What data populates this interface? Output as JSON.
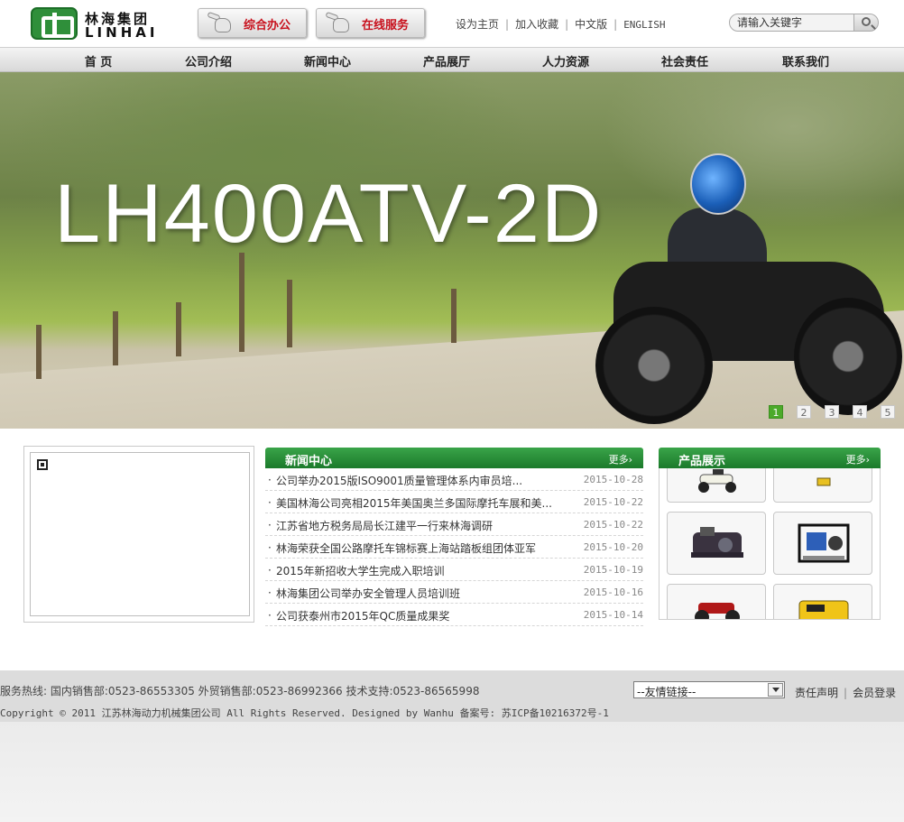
{
  "header": {
    "logo_cn": "林海集团",
    "logo_en": "LINHAI",
    "btn_office": "综合办公",
    "btn_service": "在线服务",
    "links": [
      "设为主页",
      "加入收藏",
      "中文版",
      "ENGLISH"
    ],
    "search_placeholder": "请输入关键字"
  },
  "nav": [
    "首 页",
    "公司介绍",
    "新闻中心",
    "产品展厅",
    "人力资源",
    "社会责任",
    "联系我们"
  ],
  "banner": {
    "text": "LH400ATV-2D",
    "slides": [
      "1",
      "2",
      "3",
      "4",
      "5"
    ],
    "active_slide": 0
  },
  "news": {
    "title": "新闻中心",
    "more": "更多›",
    "items": [
      {
        "title": "公司举办2015版ISO9001质量管理体系内审员培...",
        "date": "2015-10-28"
      },
      {
        "title": "美国林海公司亮相2015年美国奥兰多国际摩托车展和美...",
        "date": "2015-10-22"
      },
      {
        "title": "江苏省地方税务局局长江建平一行来林海调研",
        "date": "2015-10-22"
      },
      {
        "title": "林海荣获全国公路摩托车锦标赛上海站踏板组团体亚军",
        "date": "2015-10-20"
      },
      {
        "title": "2015年新招收大学生完成入职培训",
        "date": "2015-10-19"
      },
      {
        "title": "林海集团公司举办安全管理人员培训班",
        "date": "2015-10-16"
      },
      {
        "title": "公司获泰州市2015年QC质量成果奖",
        "date": "2015-10-14"
      }
    ]
  },
  "products": {
    "title": "产品展示",
    "more": "更多›",
    "items": [
      "scooter",
      "generator-small",
      "engine",
      "water-pump",
      "atv-red",
      "generator-yellow"
    ]
  },
  "footer": {
    "hotline": "服务热线: 国内销售部:0523-86553305 外贸销售部:0523-86992366 技术支持:0523-86565998",
    "copyright": "Copyright © 2011 江苏林海动力机械集团公司 All Rights Reserved. Designed by Wanhu 备案号: 苏ICP备10216372号-1",
    "friend_links": "--友情链接--",
    "link_statement": "责任声明",
    "link_login": "会员登录"
  },
  "colors": {
    "brand_green": "#1b7a2b",
    "accent_red": "#c8101c",
    "active_dot": "#4caa2a"
  }
}
